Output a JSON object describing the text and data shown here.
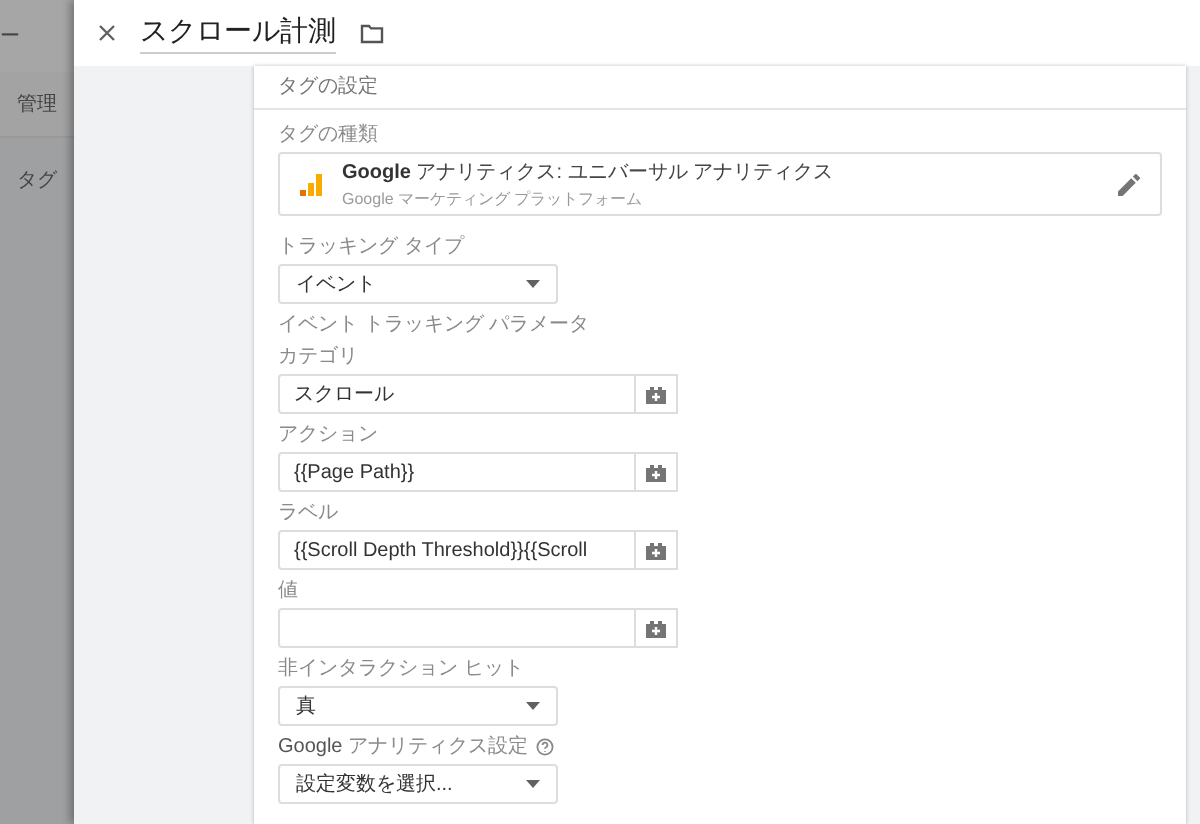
{
  "background": {
    "top_bar_text": "ー",
    "tab": "管理",
    "sidebar_item": "タグ"
  },
  "panel": {
    "title": "スクロール計測",
    "section_title": "タグの設定",
    "tag_type": {
      "label": "タグの種類",
      "name": "**Google** アナリティクス: ユニバーサル アナリティクス",
      "subtitle": "Google マーケティング プラットフォーム"
    },
    "fields": [
      {
        "kind": "select",
        "label": "トラッキング タイプ",
        "value": "イベント"
      },
      {
        "kind": "heading",
        "label": "イベント トラッキング パラメータ"
      },
      {
        "kind": "text",
        "label": "カテゴリ",
        "value": "スクロール"
      },
      {
        "kind": "text",
        "label": "アクション",
        "value": "{{Page Path}}"
      },
      {
        "kind": "text",
        "label": "ラベル",
        "value": "{{Scroll Depth Threshold}}{{Scroll"
      },
      {
        "kind": "text",
        "label": "値"
      },
      {
        "kind": "select",
        "label": "非インタラクション ヒット",
        "value": "真"
      },
      {
        "kind": "select",
        "label": "**Google** アナリティクス設定",
        "help": true,
        "value": "設定変数を選択..."
      }
    ]
  }
}
